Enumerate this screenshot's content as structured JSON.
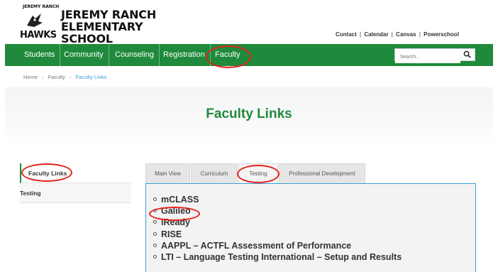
{
  "header": {
    "logo_arc": "JEREMY RANCH",
    "logo_line1": "JEREMY RANCH",
    "logo_line2": "ELEMENTARY SCHOOL",
    "logo_hawks": "HAWKS",
    "util_links": [
      "Contact",
      "Calendar",
      "Canvas",
      "Powerschool"
    ],
    "util_sep": "|"
  },
  "nav": {
    "items": [
      "Students",
      "Community",
      "Counseling",
      "Registration",
      "Faculty"
    ],
    "search_placeholder": "Search..."
  },
  "breadcrumb": {
    "items": [
      "Home",
      "Faculty",
      "Faculty Links"
    ],
    "sep": "›"
  },
  "page": {
    "title": "Faculty Links"
  },
  "sidebar": {
    "items": [
      "Faculty Links",
      "Testing"
    ]
  },
  "tabs": {
    "items": [
      "Main View",
      "Curriculum",
      "Testing",
      "Professional Development"
    ],
    "active_index": 2
  },
  "links": [
    "mCLASS",
    "Galileo",
    "iReady",
    "RISE",
    "AAPPL – ACTFL Assessment of Performance",
    "LTI – Language Testing International – Setup and Results"
  ],
  "colors": {
    "brand_green": "#1f8a3b",
    "annotation_red": "#e3231b",
    "breadcrumb_blue": "#3a9fd6"
  }
}
